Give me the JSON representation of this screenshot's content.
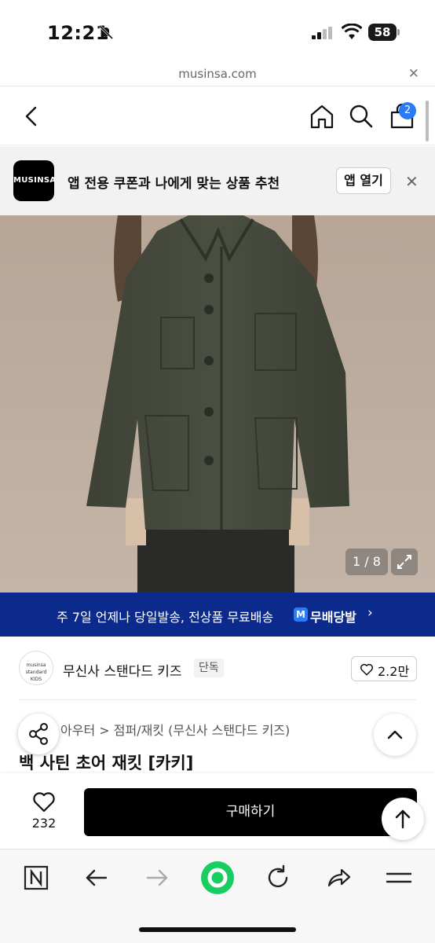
{
  "status_bar": {
    "time": "12:21",
    "battery": "58"
  },
  "url_bar": {
    "url": "musinsa.com"
  },
  "header": {
    "cart_count": "2"
  },
  "app_banner": {
    "logo_text": "MUSINSA",
    "text": "앱 전용 쿠폰과 나에게 맞는 상품 추천",
    "open_label": "앱 열기"
  },
  "gallery": {
    "counter": "1 / 8"
  },
  "promo": {
    "text": "주 7일 언제나 당일발송, 전상품 무료배송",
    "badge": "M",
    "brand": "무배당발",
    "accent": "#0b2a8c"
  },
  "brand": {
    "logo_text": "musinsa standard KIDS",
    "name": "무신사 스탠다드 키즈",
    "tag": "단독",
    "like_count": "2.2만"
  },
  "product": {
    "breadcrumb": "키즈 > 아우터 > 점퍼/재킷 (무신사 스탠다드 키즈)",
    "title": "백 사틴 초어 재킷 [카키]"
  },
  "purchase": {
    "like_count": "232",
    "buy_label": "구매하기"
  },
  "icons": {
    "header": [
      "back-icon",
      "home-icon",
      "search-icon",
      "cart-icon"
    ],
    "toolbar": [
      "naver-n-icon",
      "back-arrow-icon",
      "forward-arrow-icon",
      "green-dot-icon",
      "reload-icon",
      "share-arrow-icon",
      "menu-icon"
    ]
  }
}
